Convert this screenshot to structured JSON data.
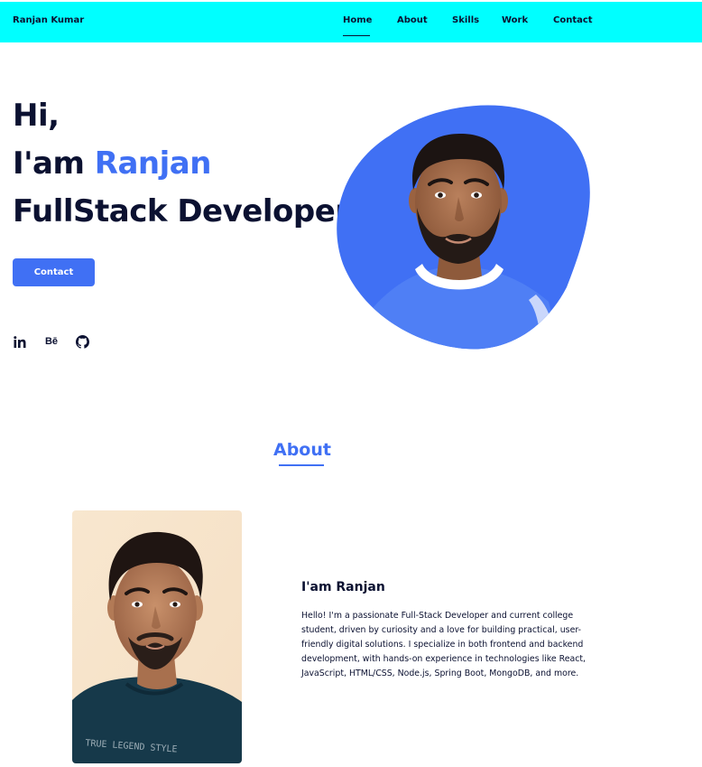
{
  "header": {
    "logo": "Ranjan Kumar",
    "nav": [
      "Home",
      "About",
      "Skills",
      "Work",
      "Contact"
    ],
    "active": "Home",
    "background_color": "#00ffff"
  },
  "hero": {
    "greeting": "Hi,",
    "intro": "I'am ",
    "name": "Ranjan",
    "role": "FullStack Developer",
    "contact_button": "Contact",
    "socials": [
      "linkedin-icon",
      "behance-icon",
      "github-icon"
    ],
    "accent_color": "#4070f4"
  },
  "about": {
    "title": "About",
    "subtitle": "I'am Ranjan",
    "description": "Hello! I'm a passionate Full-Stack Developer and current college student, driven by curiosity and a love for building practical, user-friendly digital solutions. I specialize in both frontend and backend development, with hands-on experience in technologies like React, JavaScript, HTML/CSS, Node.js, Spring Boot, MongoDB, and more.",
    "shirt_text": "TRUE LEGEND STYLE"
  }
}
